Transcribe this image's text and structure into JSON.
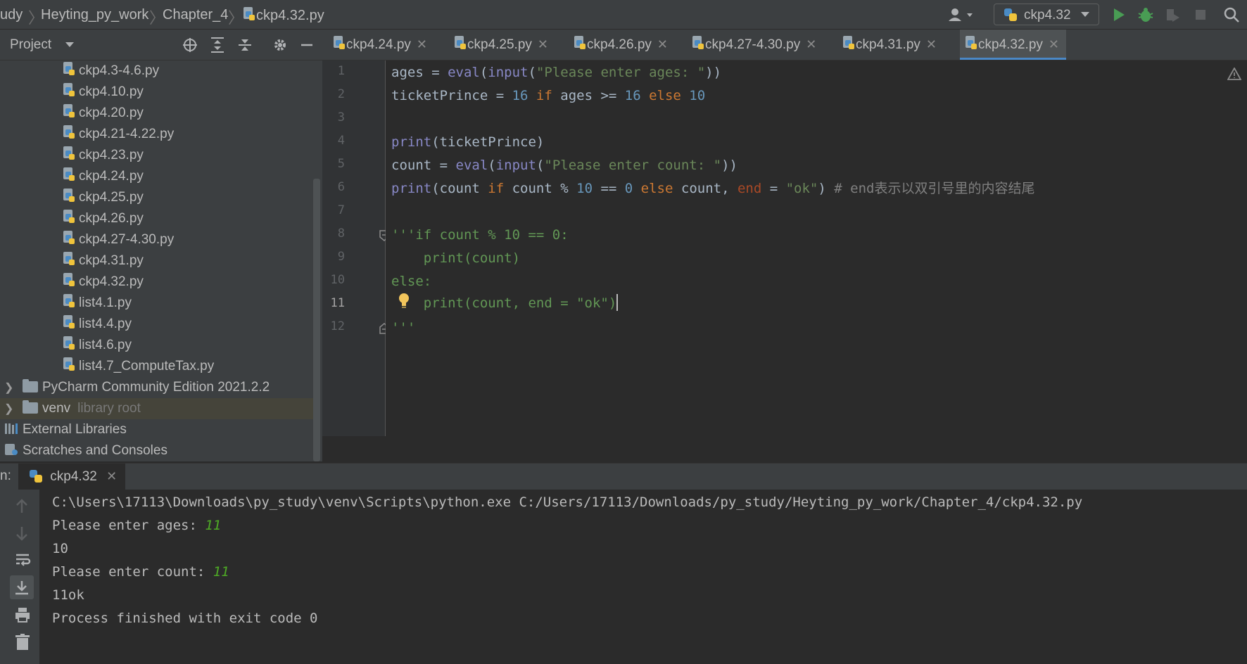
{
  "breadcrumb": {
    "items": [
      "udy",
      "Heyting_py_work",
      "Chapter_4",
      "ckp4.32.py"
    ]
  },
  "run_config": {
    "label": "ckp4.32"
  },
  "project_panel": {
    "title": "Project",
    "files": [
      "ckp4.3-4.6.py",
      "ckp4.10.py",
      "ckp4.20.py",
      "ckp4.21-4.22.py",
      "ckp4.23.py",
      "ckp4.24.py",
      "ckp4.25.py",
      "ckp4.26.py",
      "ckp4.27-4.30.py",
      "ckp4.31.py",
      "ckp4.32.py",
      "list4.1.py",
      "list4.4.py",
      "list4.6.py",
      "list4.7_ComputeTax.py"
    ],
    "folders": [
      {
        "label": "PyCharm Community Edition 2021.2.2",
        "hint": ""
      },
      {
        "label": "venv",
        "hint": "library root"
      }
    ],
    "external_libraries": "External Libraries",
    "scratches": "Scratches and Consoles"
  },
  "tabs": [
    {
      "label": "ckp4.24.py",
      "active": false
    },
    {
      "label": "ckp4.25.py",
      "active": false
    },
    {
      "label": "ckp4.26.py",
      "active": false
    },
    {
      "label": "ckp4.27-4.30.py",
      "active": false
    },
    {
      "label": "ckp4.31.py",
      "active": false
    },
    {
      "label": "ckp4.32.py",
      "active": true
    }
  ],
  "editor": {
    "line_numbers": [
      "1",
      "2",
      "3",
      "4",
      "5",
      "6",
      "7",
      "8",
      "9",
      "10",
      "11",
      "12"
    ],
    "current_line": "11",
    "code": {
      "l1": [
        "ages = ",
        "eval",
        "(",
        "input",
        "(",
        "\"Please enter ages: \"",
        "))"
      ],
      "l2": [
        "ticketPrince = ",
        "16",
        " if ",
        "ages >= ",
        "16",
        " else ",
        "10"
      ],
      "l4": [
        "print",
        "(ticketPrince)"
      ],
      "l5": [
        "count = ",
        "eval",
        "(",
        "input",
        "(",
        "\"Please enter count: \"",
        "))"
      ],
      "l6": [
        "print",
        "(count ",
        "if",
        " count % ",
        "10",
        " == ",
        "0",
        " else",
        " count, ",
        "end",
        " = ",
        "\"ok\"",
        ") ",
        "# end表示以双引号里的内容结尾"
      ],
      "l8": "'''if count % 10 == 0:",
      "l9": "    print(count)",
      "l10": "else:",
      "l11": "    print(count, end = \"ok\")",
      "l12": "'''"
    }
  },
  "run_panel": {
    "label": "n:",
    "tab": "ckp4.32",
    "console": {
      "cmd": "C:\\Users\\17113\\Downloads\\py_study\\venv\\Scripts\\python.exe C:/Users/17113/Downloads/py_study/Heyting_py_work/Chapter_4/ckp4.32.py",
      "prompt1": "Please enter ages: ",
      "input1": "11",
      "out1": "10",
      "prompt2": "Please enter count: ",
      "input2": "11",
      "out2": "11ok",
      "exit": "Process finished with exit code 0"
    }
  }
}
